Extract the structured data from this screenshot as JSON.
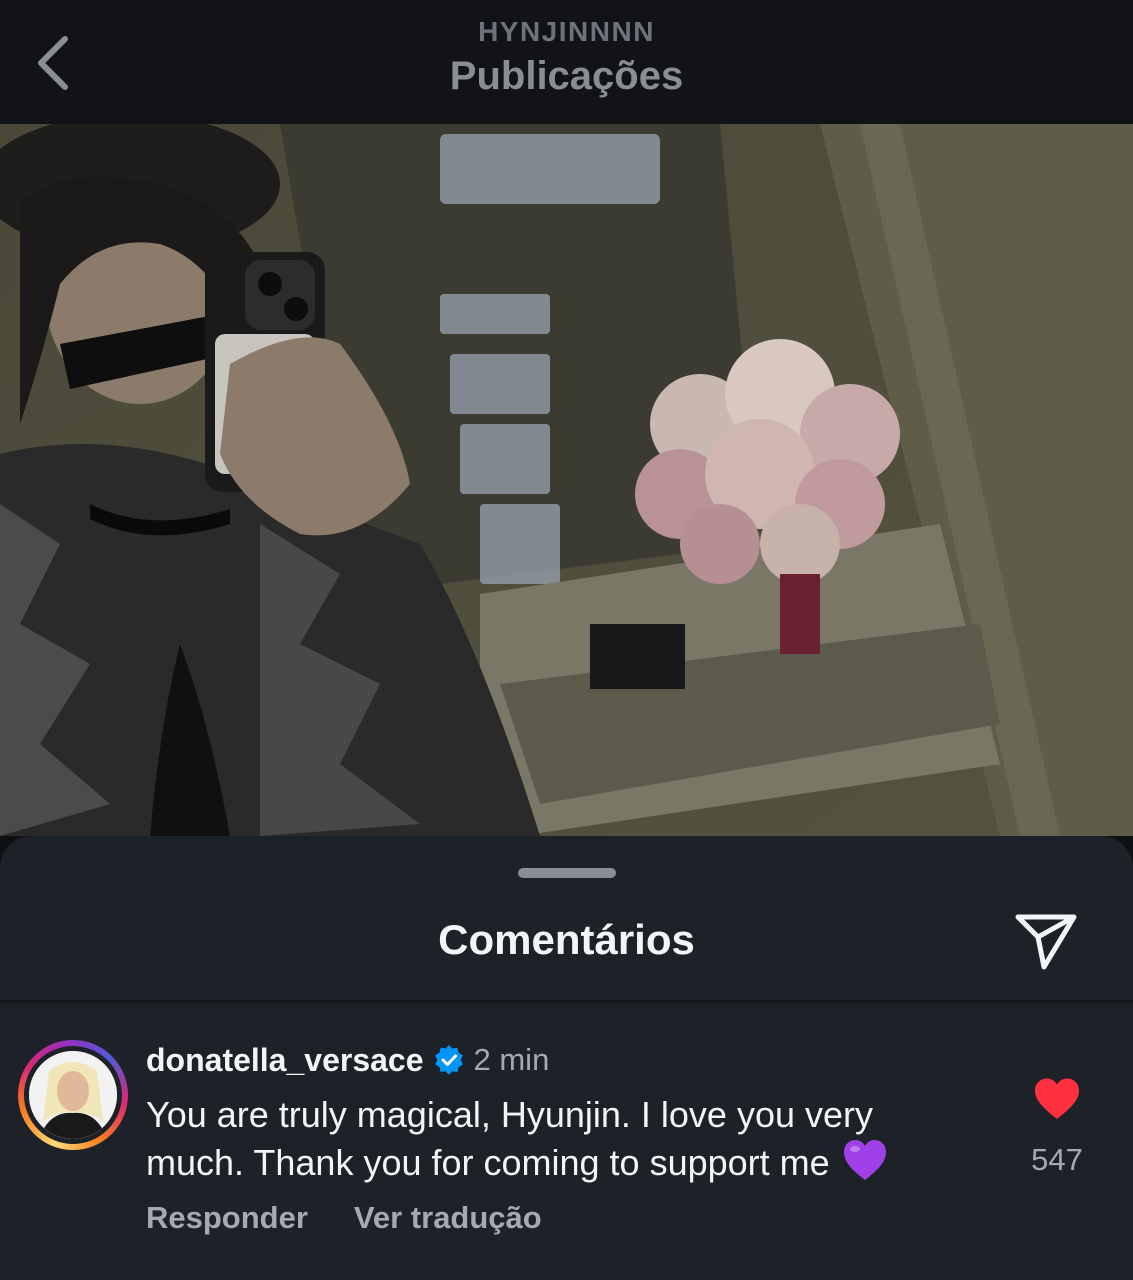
{
  "header": {
    "username": "HYNJINNNN",
    "title": "Publicações",
    "back_icon": "chevron-left-icon"
  },
  "post": {
    "image_description_icon": "photo"
  },
  "comments_sheet": {
    "title": "Comentários",
    "share_icon": "send-icon",
    "comment": {
      "username": "donatella_versace",
      "verified": true,
      "time": "2 min",
      "text": "You are truly magical, Hyunjin. I love you very much. Thank you for coming to support me",
      "emoji_icon": "purple-heart-icon",
      "liked": true,
      "like_count": "547",
      "reply_label": "Responder",
      "translate_label": "Ver tradução"
    }
  },
  "colors": {
    "like_red": "#ff3040",
    "verified_blue": "#0095f6",
    "purple_heart": "#a040e8"
  }
}
